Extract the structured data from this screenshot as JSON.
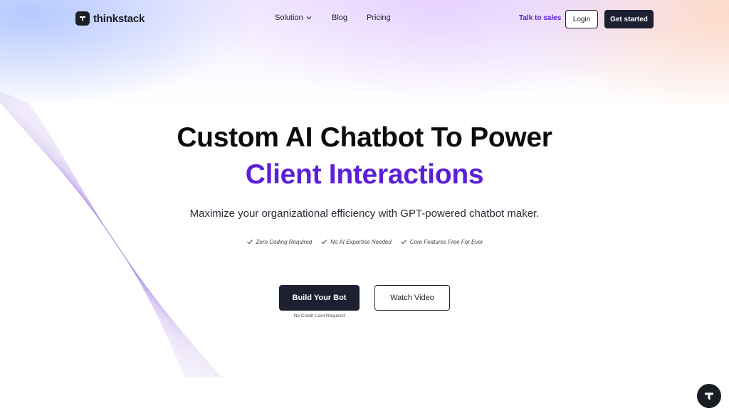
{
  "brand": {
    "name": "thinkstack",
    "logo_icon": "thinkstack-logo-icon"
  },
  "nav": {
    "links": [
      {
        "label": "Solution",
        "has_dropdown": true
      },
      {
        "label": "Blog"
      },
      {
        "label": "Pricing"
      }
    ],
    "talk_to_sales": "Talk to sales",
    "login": "Login",
    "get_started": "Get started"
  },
  "hero": {
    "title_line1": "Custom AI Chatbot To Power",
    "title_line2": "Client Interactions",
    "subtitle": "Maximize your organizational efficiency with GPT-powered chatbot maker.",
    "features": [
      "Zero Coding Required",
      "No AI Expertise Needed",
      "Core Features Free For Ever"
    ],
    "primary_cta": "Build Your Bot",
    "secondary_cta": "Watch Video",
    "cta_note": "No Credit Card Required"
  },
  "colors": {
    "accent_purple": "#5b1fd9",
    "dark_button": "#1d2030"
  },
  "chat_widget": {
    "icon": "chat-launcher-icon"
  }
}
